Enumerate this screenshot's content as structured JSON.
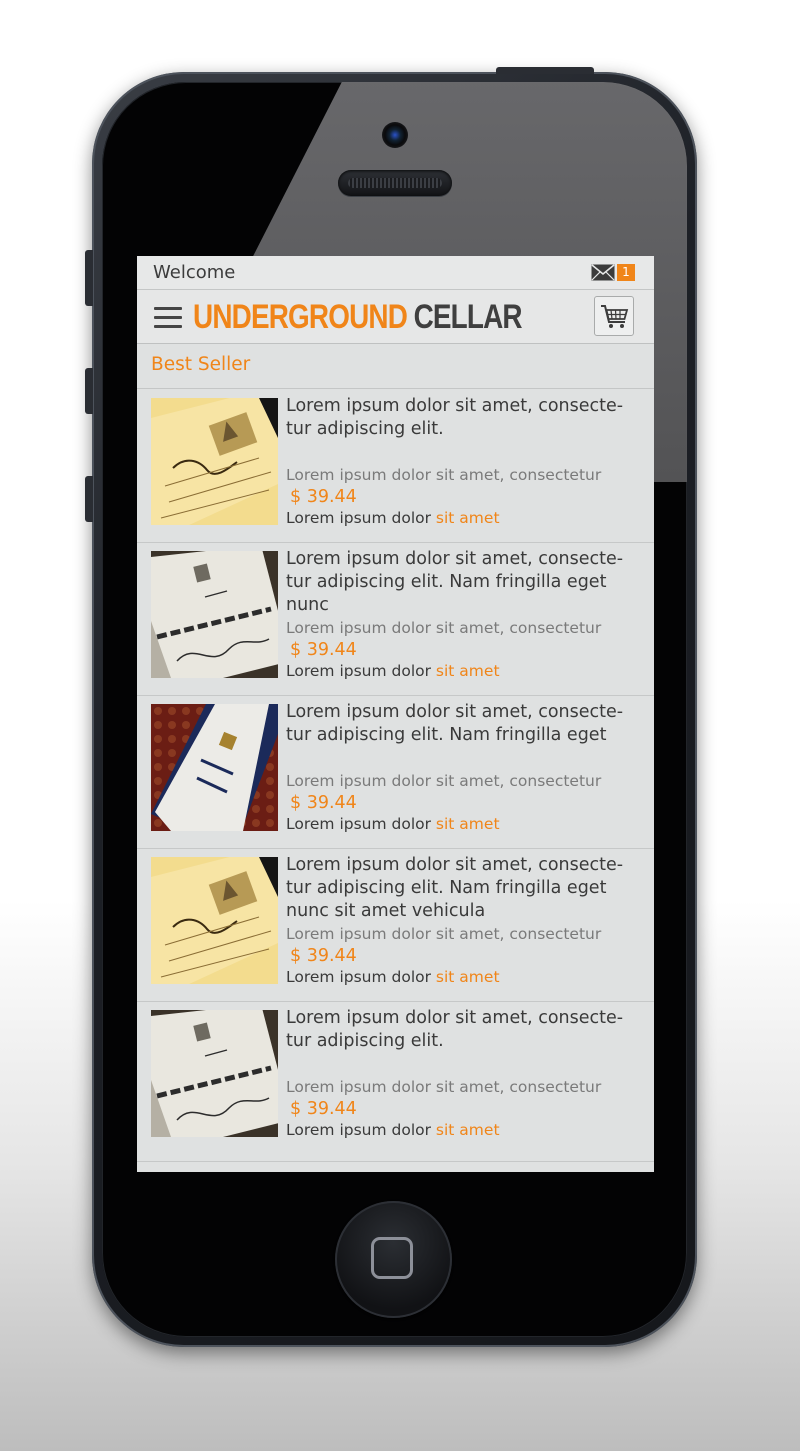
{
  "status": {
    "welcome": "Welcome",
    "mail_icon": "mail-icon",
    "unread_count": "1"
  },
  "header": {
    "menu_icon": "hamburger-menu-icon",
    "brand_primary": "UNDERGROUND",
    "brand_secondary": "CELLAR",
    "cart_icon": "shopping-cart-icon"
  },
  "section": {
    "title": "Best Seller"
  },
  "items": [
    {
      "title": "Lorem ipsum dolor sit amet, consecte-tur adipiscing elit.",
      "subtitle": "Lorem ipsum dolor sit amet, consectetur",
      "price": "$ 39.44",
      "meta_text": "Lorem ipsum dolor ",
      "meta_link": "sit amet"
    },
    {
      "title": "Lorem ipsum dolor sit amet, consecte-tur adipiscing elit. Nam fringilla eget nunc",
      "subtitle": "Lorem ipsum dolor sit amet, consectetur",
      "price": "$ 39.44",
      "meta_text": "Lorem ipsum dolor ",
      "meta_link": "sit amet"
    },
    {
      "title": "Lorem ipsum dolor sit amet, consecte-tur adipiscing elit. Nam fringilla eget",
      "subtitle": "Lorem ipsum dolor sit amet, consectetur",
      "price": "$ 39.44",
      "meta_text": "Lorem ipsum dolor ",
      "meta_link": "sit amet"
    },
    {
      "title": "Lorem ipsum dolor sit amet, consecte-tur adipiscing elit. Nam fringilla eget nunc sit amet vehicula",
      "subtitle": "Lorem ipsum dolor sit amet, consectetur",
      "price": "$ 39.44",
      "meta_text": "Lorem ipsum dolor ",
      "meta_link": "sit amet"
    },
    {
      "title": "Lorem ipsum dolor sit amet, consecte-tur adipiscing elit.",
      "subtitle": "Lorem ipsum dolor sit amet, consectetur",
      "price": "$ 39.44",
      "meta_text": "Lorem ipsum dolor ",
      "meta_link": "sit amet"
    }
  ],
  "colors": {
    "accent": "#f08519",
    "text": "#3a3a3a",
    "screen_bg": "#dfe1e1"
  }
}
